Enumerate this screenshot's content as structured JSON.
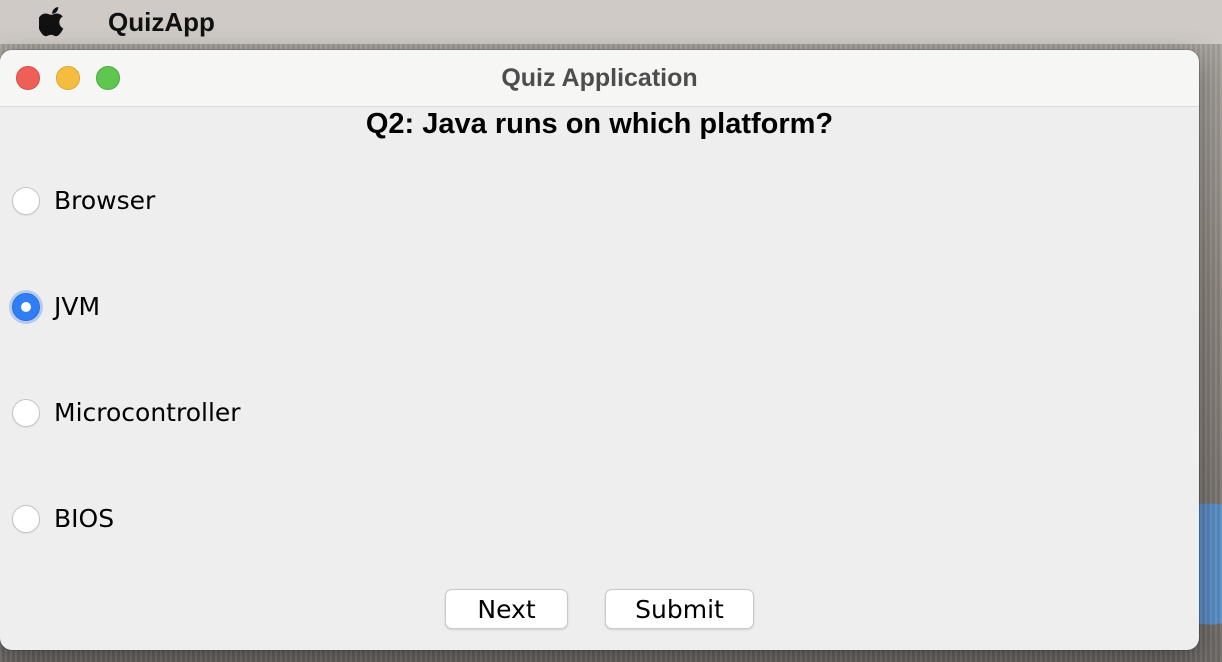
{
  "menubar": {
    "app_name": "QuizApp"
  },
  "window": {
    "title": "Quiz Application"
  },
  "quiz": {
    "question": "Q2: Java runs on which platform?",
    "options": [
      {
        "label": "Browser",
        "selected": false
      },
      {
        "label": "JVM",
        "selected": true
      },
      {
        "label": "Microcontroller",
        "selected": false
      },
      {
        "label": "BIOS",
        "selected": false
      }
    ],
    "selected_option": "JVM"
  },
  "buttons": {
    "next_label": "Next",
    "submit_label": "Submit"
  },
  "colors": {
    "radio_selected": "#2f7ef5",
    "traffic_close": "#ee5f57",
    "traffic_minimize": "#f5bd40",
    "traffic_maximize": "#5fc650"
  }
}
